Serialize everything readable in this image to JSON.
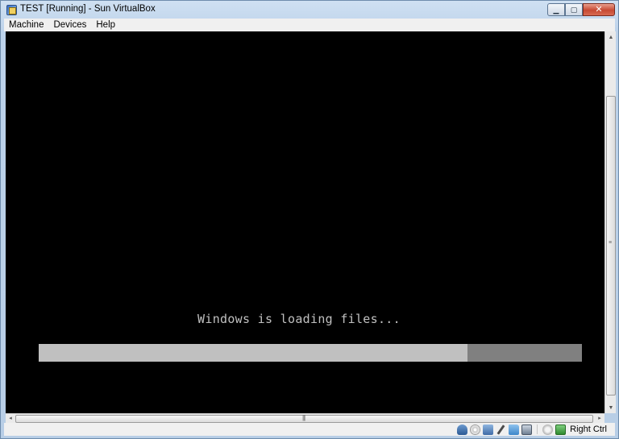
{
  "window": {
    "title": "TEST [Running] - Sun VirtualBox",
    "controls": {
      "minimize": "▁",
      "maximize": "▢",
      "close": "✕"
    }
  },
  "menu": {
    "items": [
      "Machine",
      "Devices",
      "Help"
    ]
  },
  "vm_screen": {
    "message": "Windows is loading files...",
    "progress_fraction": 0.79,
    "colors": {
      "background": "#000000",
      "text": "#c0c0c0",
      "bar_fill": "#c0c0c0",
      "bar_track": "#808080"
    }
  },
  "scrollbars": {
    "up_arrow": "▲",
    "down_arrow": "▼",
    "left_arrow": "◂",
    "right_arrow": "▸",
    "grip": "≡",
    "hgrip": "|||"
  },
  "statusbar": {
    "icons": [
      "hard-disk-icon",
      "cd-dvd-icon",
      "network-icon",
      "usb-icon",
      "shared-folders-icon",
      "display-icon",
      "mouse-integration-icon",
      "host-key-icon"
    ],
    "host_key_label": "Right Ctrl"
  }
}
